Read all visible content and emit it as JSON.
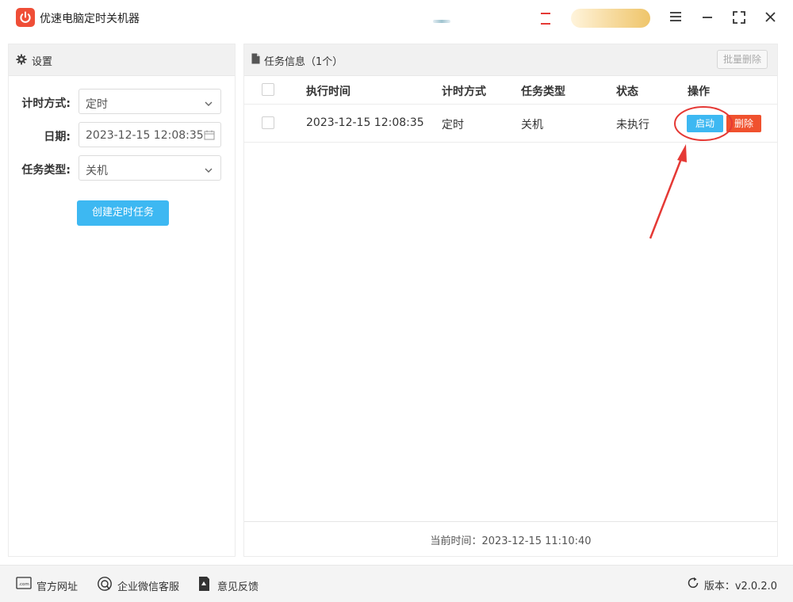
{
  "app": {
    "title": "优速电脑定时关机器"
  },
  "settings": {
    "header": "设置",
    "timing_label": "计时方式:",
    "timing_value": "定时",
    "date_label": "日期:",
    "date_value": "2023-12-15 12:08:35",
    "task_type_label": "任务类型:",
    "task_type_value": "关机",
    "create_button": "创建定时任务"
  },
  "tasks": {
    "header": "任务信息（1个）",
    "batch_delete": "批量删除",
    "columns": {
      "exec_time": "执行时间",
      "timing": "计时方式",
      "task_type": "任务类型",
      "status": "状态",
      "actions": "操作"
    },
    "rows": [
      {
        "exec_time": "2023-12-15 12:08:35",
        "timing": "定时",
        "task_type": "关机",
        "status": "未执行",
        "start_label": "启动",
        "delete_label": "删除"
      }
    ],
    "current_time": "当前时间：2023-12-15 11:10:40"
  },
  "footer": {
    "website": "官方网址",
    "wechat": "企业微信客服",
    "feedback": "意见反馈",
    "version": "版本：v2.0.2.0"
  },
  "colors": {
    "accent": "#3db8f2",
    "danger": "#f0512e",
    "logo": "#ef4e37",
    "annotation": "#e53935"
  }
}
